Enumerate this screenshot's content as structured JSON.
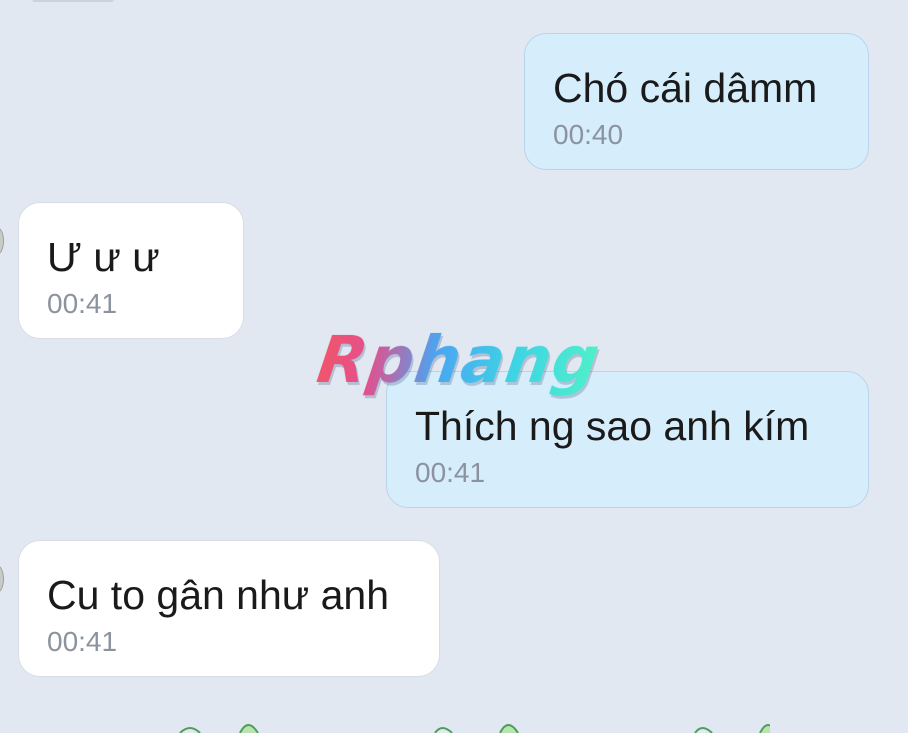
{
  "messages": [
    {
      "direction": "sent",
      "text": "Chó cái dâmm",
      "time": "00:40"
    },
    {
      "direction": "received",
      "text": "Ư ư ư",
      "time": "00:41"
    },
    {
      "direction": "sent",
      "text": "Thích ng sao anh kím",
      "time": "00:41"
    },
    {
      "direction": "received",
      "text": "Cu to gân như anh",
      "time": "00:41"
    }
  ],
  "watermark": {
    "text": "Rphang"
  },
  "colors": {
    "background": "#e2e8f1",
    "sent_bubble": "#d6edfb",
    "received_bubble": "#ffffff",
    "message_text": "#1a1a1a",
    "time_text": "#8b939e"
  }
}
